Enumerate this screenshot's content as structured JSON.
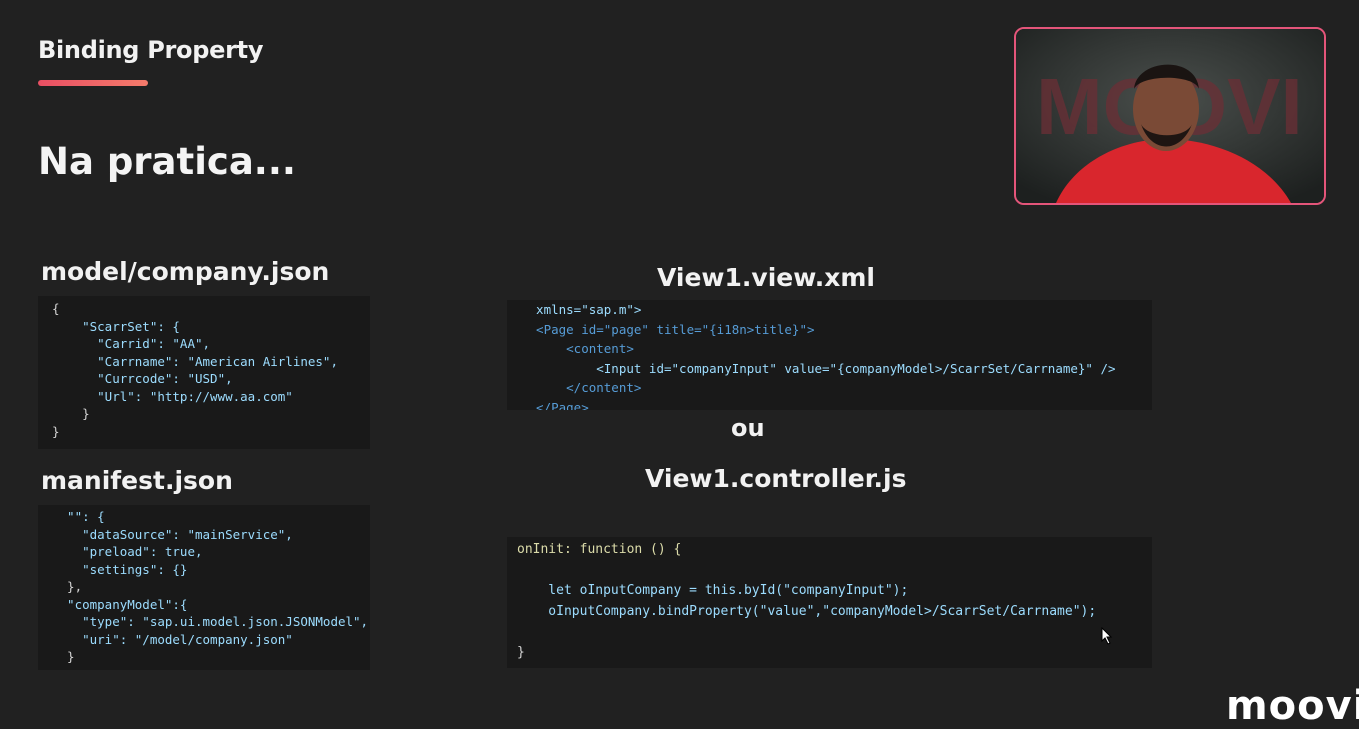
{
  "slide": {
    "title": "Binding Property",
    "subtitle": "Na pratica...",
    "sections": {
      "company_json": "model/company.json",
      "manifest_json": "manifest.json",
      "view_xml": "View1.view.xml",
      "or": "ou",
      "controller_js": "View1.controller.js"
    }
  },
  "code": {
    "company_json": [
      "{",
      "    \"ScarrSet\": {",
      "      \"Carrid\": \"AA\",",
      "      \"Carrname\": \"American Airlines\",",
      "      \"Currcode\": \"USD\",",
      "      \"Url\": \"http://www.aa.com\"",
      "    }",
      "}"
    ],
    "manifest_json": [
      "  \"\": {",
      "    \"dataSource\": \"mainService\",",
      "    \"preload\": true,",
      "    \"settings\": {}",
      "  },",
      "  \"companyModel\":{",
      "    \"type\": \"sap.ui.model.json.JSONModel\",",
      "    \"uri\": \"/model/company.json\"",
      "  }"
    ],
    "view_xml": [
      "  xmlns=\"sap.m\">",
      "  <Page id=\"page\" title=\"{i18n>title}\">",
      "      <content>",
      "          <Input id=\"companyInput\" value=\"{companyModel>/ScarrSet/Carrname}\" />",
      "      </content>",
      "  </Page>"
    ],
    "controller_js": [
      "onInit: function () {",
      "",
      "    let oInputCompany = this.byId(\"companyInput\");",
      "    oInputCompany.bindProperty(\"value\",\"companyModel>/ScarrSet/Carrname\");",
      "",
      "}"
    ]
  },
  "branding": {
    "logo_text": "moovi",
    "video_logo_text": "MOOVI",
    "accent_color": "#e94f63"
  }
}
